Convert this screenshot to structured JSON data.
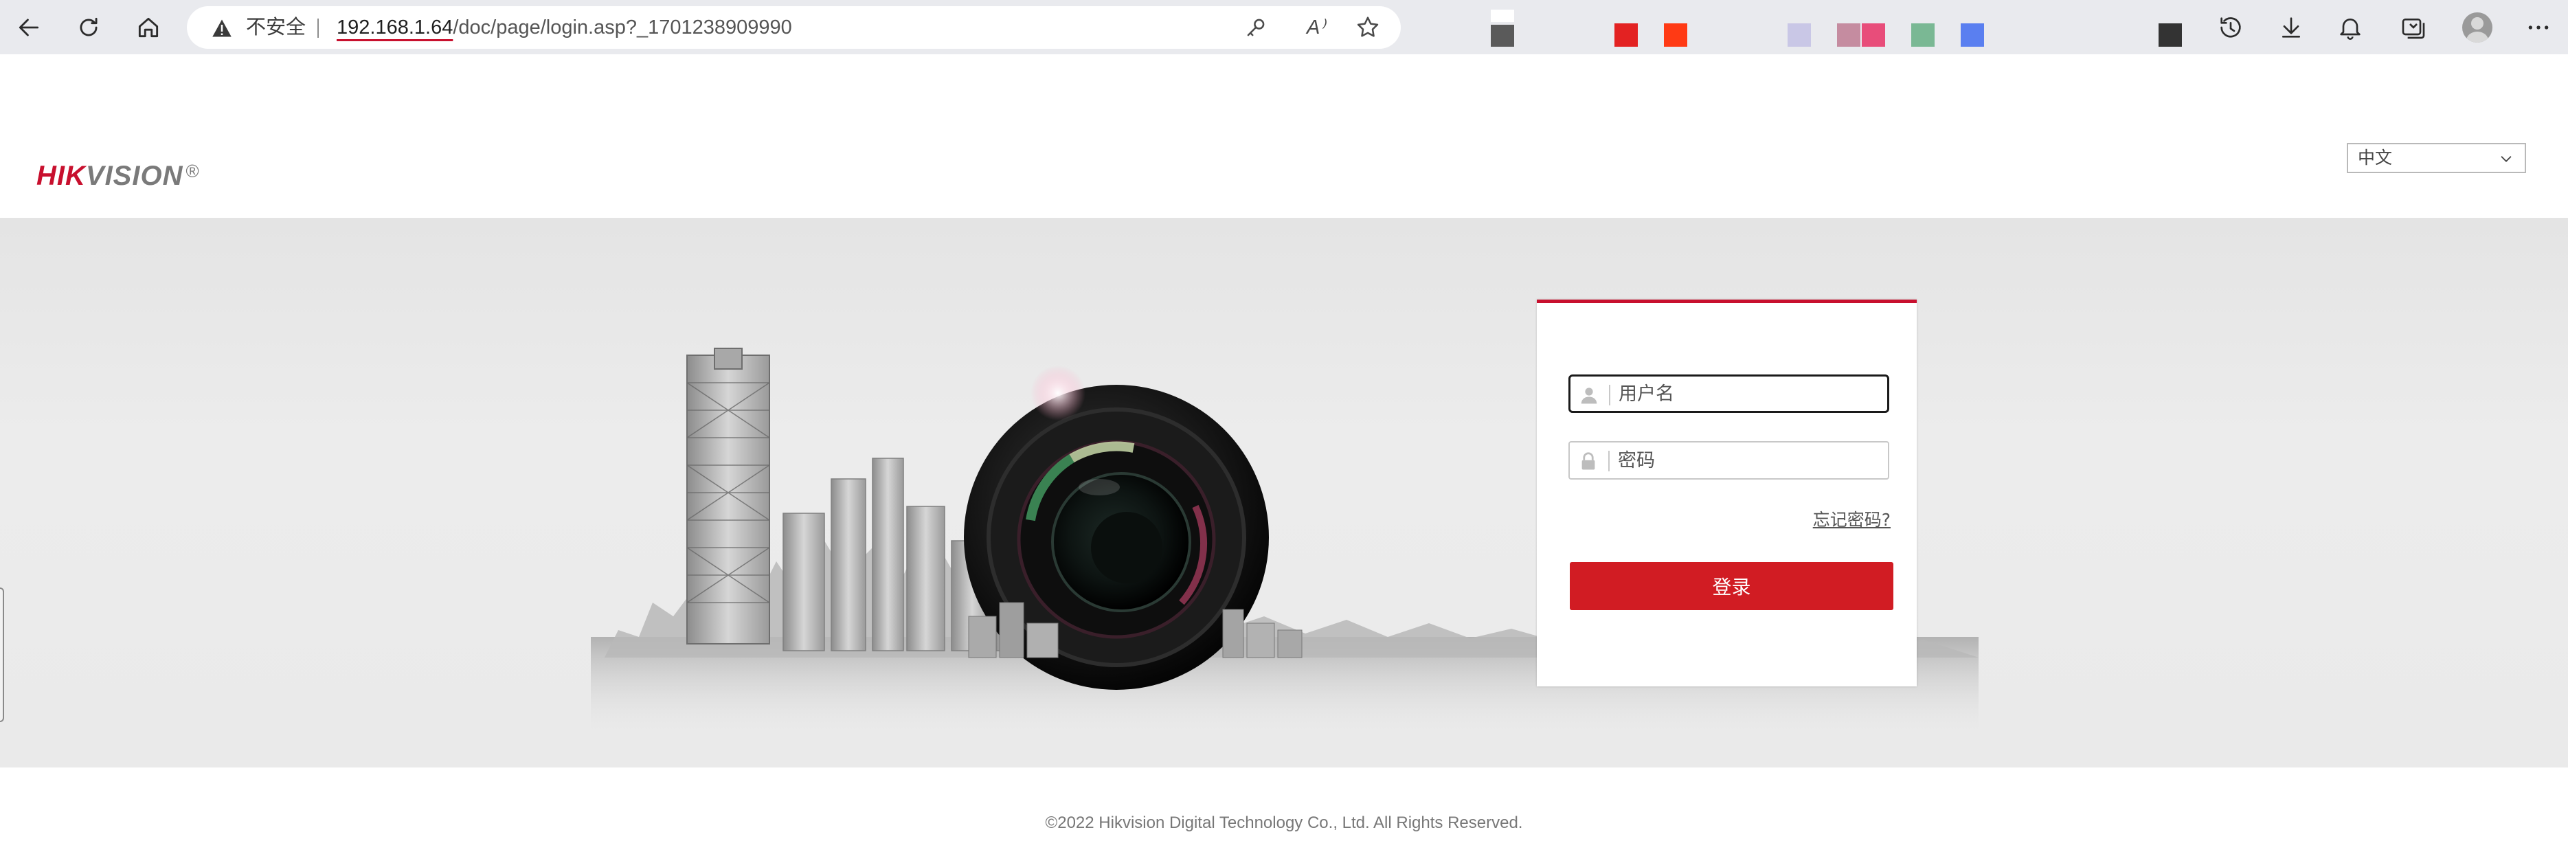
{
  "browser": {
    "security_label": "不安全",
    "url_host": "192.168.1.64",
    "url_path": "/doc/page/login.asp?_1701238909990",
    "read_aloud_glyph": "A⁾",
    "bookmark_colors": [
      "#5a5a5a",
      "#e32222",
      "#ff3a14",
      "#c9c7e6",
      "#c58ca0",
      "#e84d7a",
      "#7ab894",
      "#5a7ff0",
      "#333333"
    ]
  },
  "header": {
    "logo_red": "HIK",
    "logo_gray": "VISION",
    "logo_mark": "®",
    "language": "中文"
  },
  "login": {
    "username_placeholder": "用户名",
    "password_placeholder": "密码",
    "forgot_label": "忘记密码?",
    "login_button": "登录",
    "accent_color": "#c8102e"
  },
  "footer": {
    "copyright": "©2022 Hikvision Digital Technology Co., Ltd. All Rights Reserved."
  }
}
